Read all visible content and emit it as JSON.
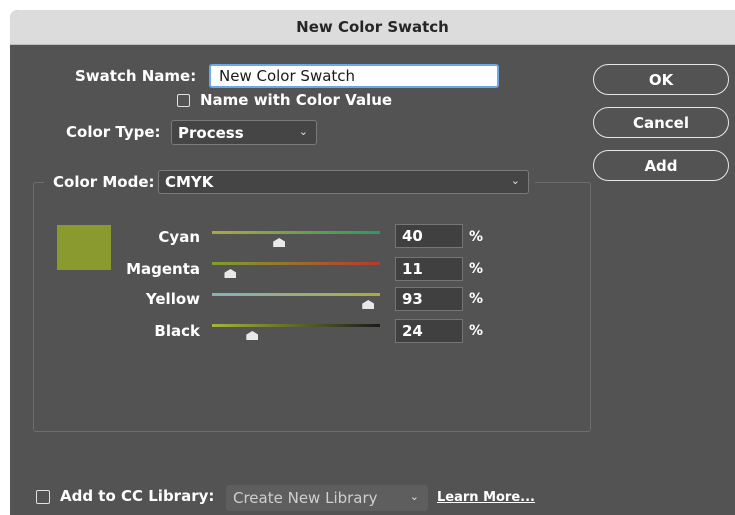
{
  "window": {
    "title": "New Color Swatch"
  },
  "swatch_name": {
    "label": "Swatch Name:",
    "value": "New Color Swatch"
  },
  "name_with_color_value": {
    "label": "Name with Color Value",
    "checked": false
  },
  "color_type": {
    "label": "Color Type:",
    "value": "Process"
  },
  "color_mode": {
    "label": "Color Mode:",
    "value": "CMYK"
  },
  "buttons": {
    "ok": "OK",
    "cancel": "Cancel",
    "add": "Add"
  },
  "preview_color": "#8a9a2e",
  "channels": [
    {
      "label": "Cyan",
      "value": "40",
      "unit": "%",
      "percent": 40
    },
    {
      "label": "Magenta",
      "value": "11",
      "unit": "%",
      "percent": 11
    },
    {
      "label": "Yellow",
      "value": "93",
      "unit": "%",
      "percent": 93
    },
    {
      "label": "Black",
      "value": "24",
      "unit": "%",
      "percent": 24
    }
  ],
  "footer": {
    "add_to_library_label": "Add to CC Library:",
    "add_to_library_checked": false,
    "library_value": "Create New Library",
    "learn_more": "Learn More..."
  },
  "colors": {
    "dialog_bg": "#535353",
    "titlebar_bg": "#dcdcdc",
    "input_focus": "#6aa8e8"
  },
  "icons": {
    "dropdown": "chevron-down-icon",
    "slider_thumb": "triangle-thumb-icon"
  }
}
